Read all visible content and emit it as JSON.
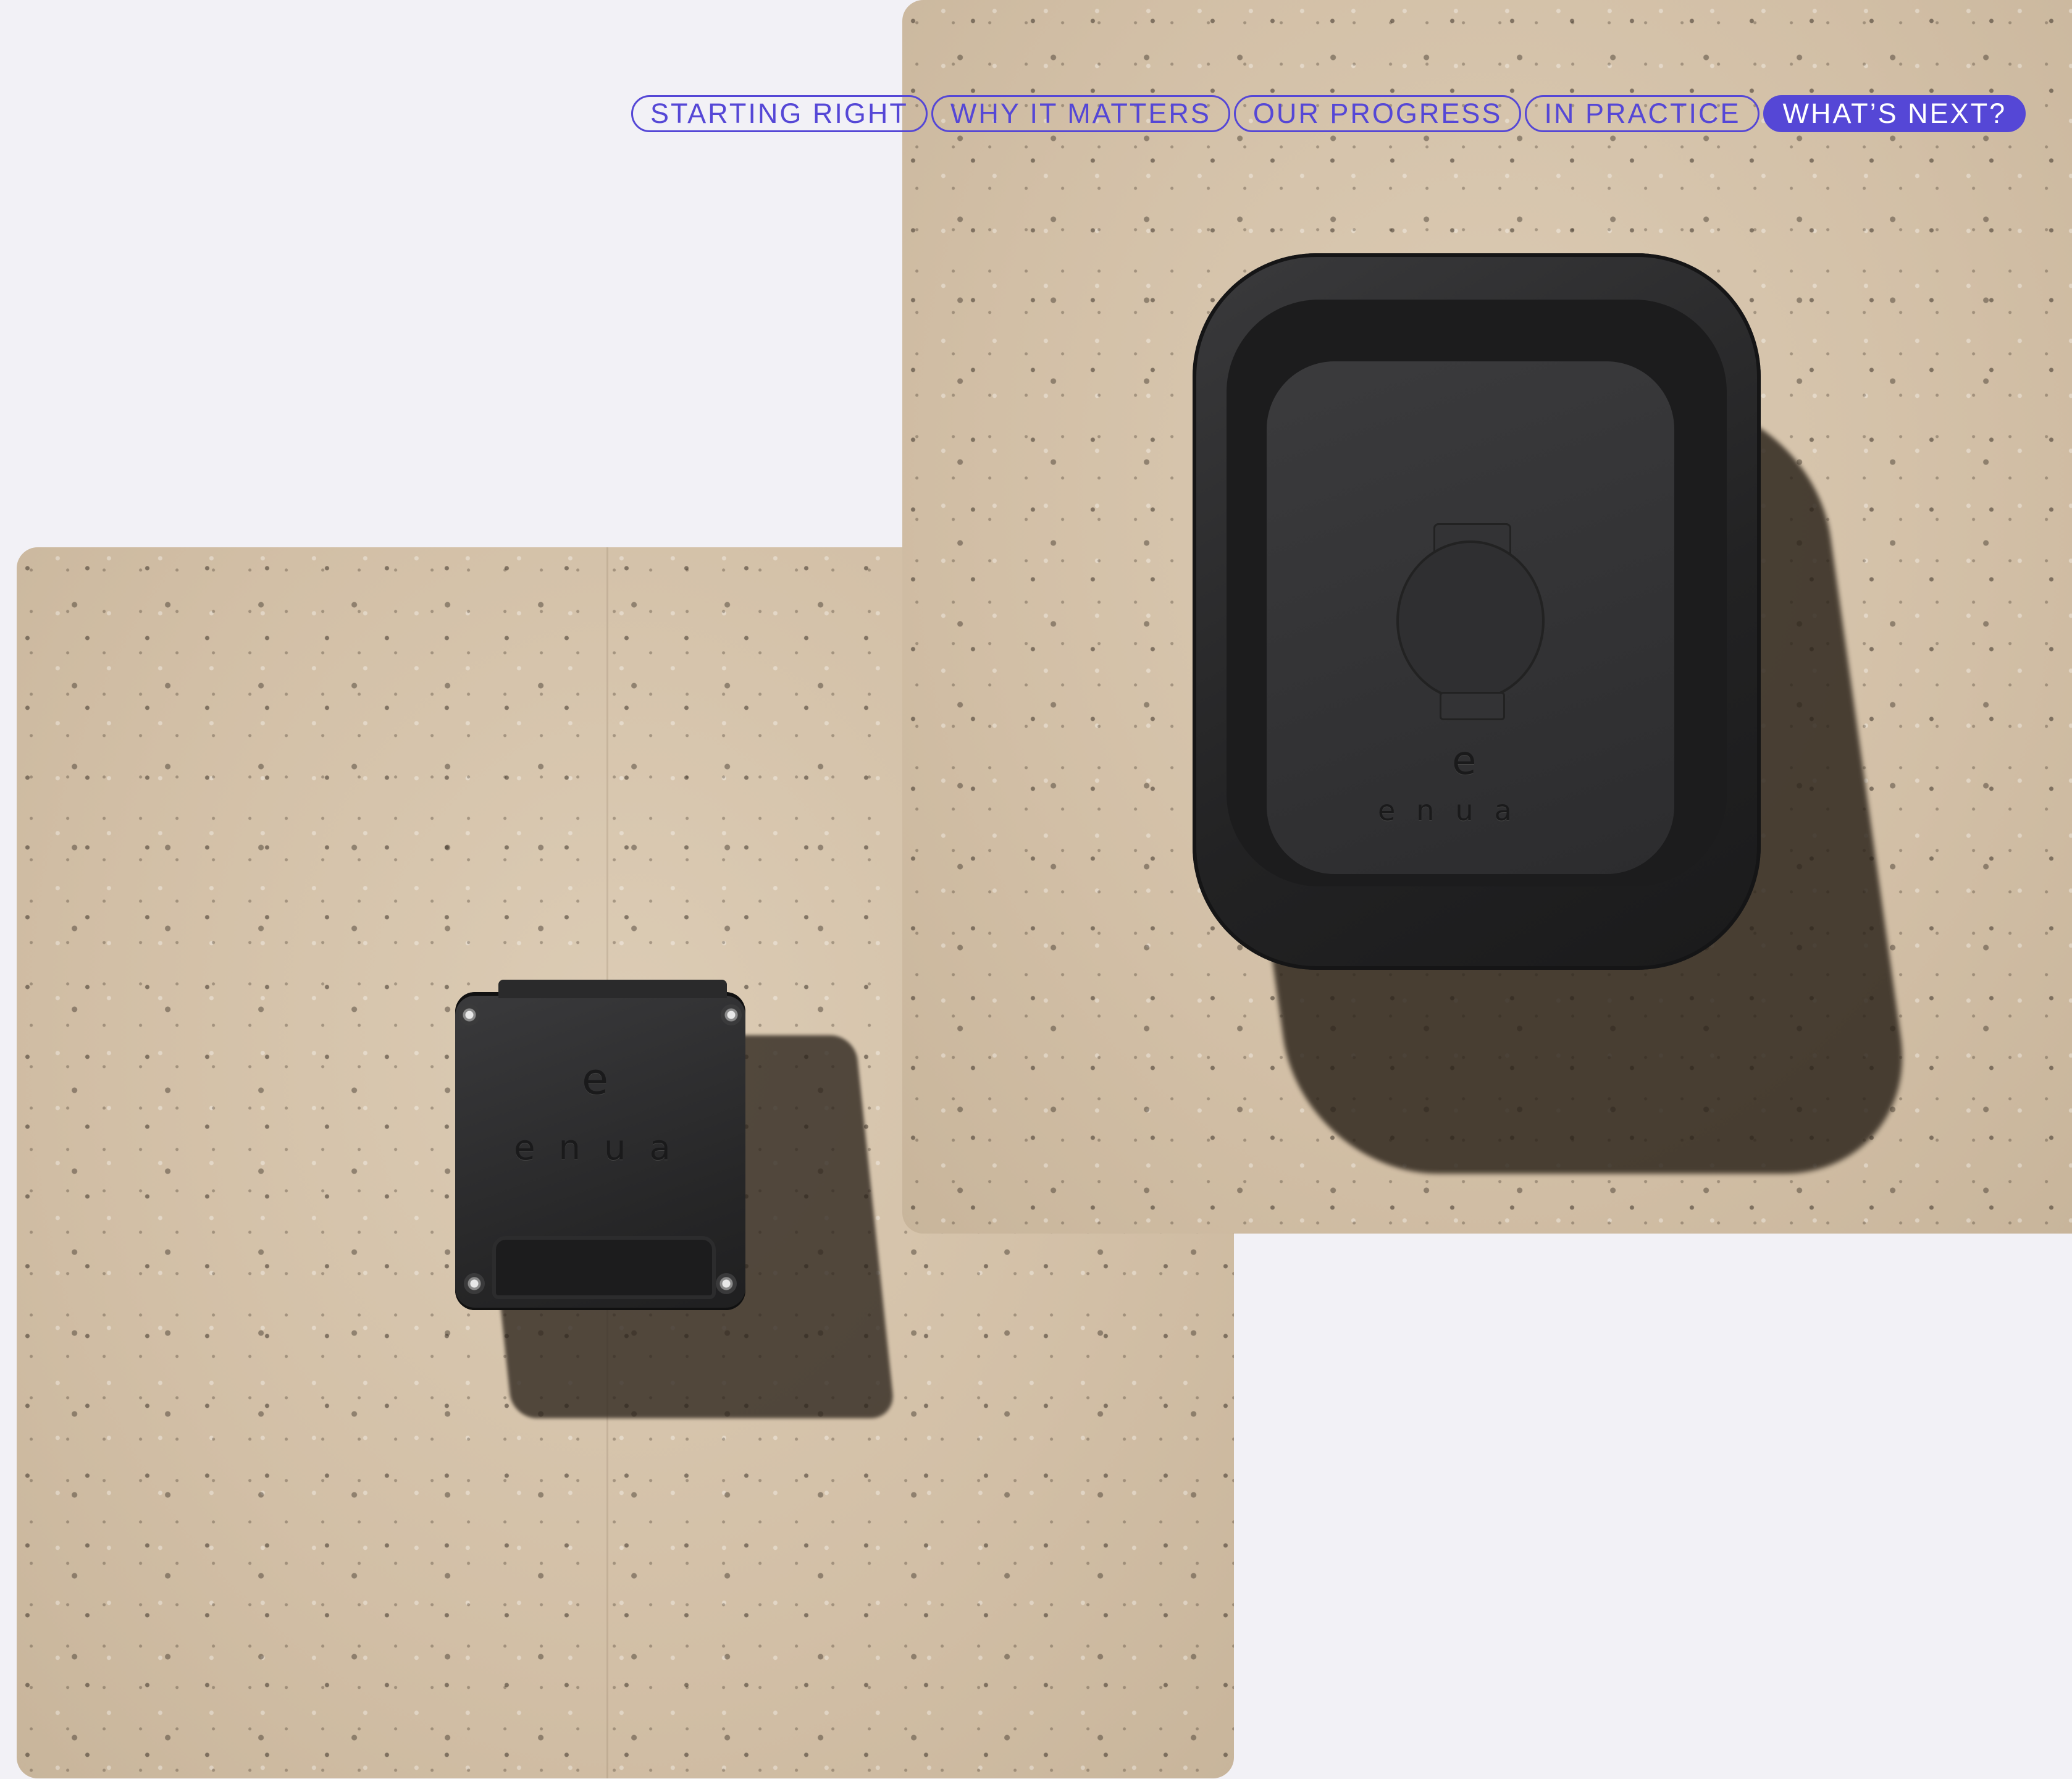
{
  "nav": {
    "items": [
      {
        "label": "STARTING RIGHT"
      },
      {
        "label": "WHY IT MATTERS"
      },
      {
        "label": "OUR PROGRESS"
      },
      {
        "label": "IN PRACTICE"
      },
      {
        "label": "WHAT’S NEXT?"
      }
    ],
    "active_index": 4,
    "accent_color": "#5547d6"
  },
  "photos": {
    "top": {
      "logo_letter": "e",
      "logo_word": "enua"
    },
    "bottom": {
      "logo_letter": "e",
      "logo_word": "enua"
    }
  },
  "colors": {
    "background": "#f2f1f6",
    "concrete": "#d2bfa6",
    "device": "#2a2a2b"
  }
}
